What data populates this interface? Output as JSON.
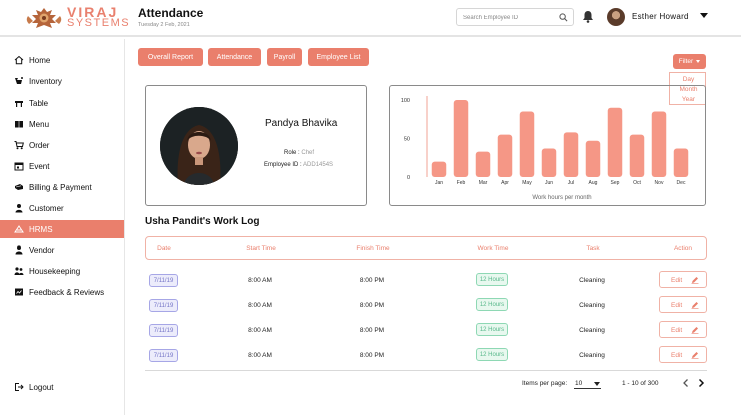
{
  "brand": {
    "line1": "VIRAJ",
    "line2": "SYSTEMS",
    "accent": "#ea7f6c"
  },
  "header": {
    "title": "Attendance",
    "date": "Tuesday 2 Feb, 2021",
    "search_placeholder": "Search Employee ID",
    "user_name": "Esther Howard"
  },
  "sidebar": {
    "items": [
      {
        "label": "Home",
        "icon": "home-icon"
      },
      {
        "label": "Inventory",
        "icon": "inventory-icon"
      },
      {
        "label": "Table",
        "icon": "table-icon"
      },
      {
        "label": "Menu",
        "icon": "menu-book-icon"
      },
      {
        "label": "Order",
        "icon": "cart-icon"
      },
      {
        "label": "Event",
        "icon": "calendar-icon"
      },
      {
        "label": "Billing & Payment",
        "icon": "billing-icon"
      },
      {
        "label": "Customer",
        "icon": "person-icon"
      },
      {
        "label": "HRMS",
        "icon": "hrms-icon"
      },
      {
        "label": "Vendor",
        "icon": "vendor-icon"
      },
      {
        "label": "Housekeeping",
        "icon": "housekeeping-icon"
      },
      {
        "label": "Feedback & Reviews",
        "icon": "feedback-icon"
      }
    ],
    "active": "HRMS",
    "logout": "Logout"
  },
  "tabs": [
    "Overall Report",
    "Attendance",
    "Payroll",
    "Employee List"
  ],
  "filter": {
    "label": "Filter",
    "options": [
      "Day",
      "Month",
      "Year"
    ]
  },
  "profile": {
    "name": "Pandya Bhavika",
    "role_label": "Role :",
    "role": "Chef",
    "id_label": "Employee ID :",
    "id": "ADD1454S"
  },
  "chart_data": {
    "type": "bar",
    "categories": [
      "Jan",
      "Feb",
      "Mar",
      "Apr",
      "May",
      "Jun",
      "Jul",
      "Aug",
      "Sep",
      "Oct",
      "Nov",
      "Dec"
    ],
    "values": [
      20,
      100,
      33,
      55,
      85,
      37,
      58,
      47,
      90,
      55,
      85,
      37
    ],
    "yticks": [
      "100",
      "50",
      "0"
    ],
    "ylim": [
      0,
      100
    ],
    "xlabel": "Work hours per month",
    "bar_color": "#f59786"
  },
  "work_log": {
    "title": "Usha Pandit's Work Log",
    "columns": [
      "Date",
      "Start Time",
      "Finish Time",
      "Work Time",
      "Task",
      "Action"
    ],
    "rows": [
      {
        "date": "7/11/19",
        "start": "8:00 AM",
        "finish": "8:00 PM",
        "work": "12 Hours",
        "task": "Cleaning",
        "action": "Edit"
      },
      {
        "date": "7/11/19",
        "start": "8:00 AM",
        "finish": "8:00 PM",
        "work": "12 Hours",
        "task": "Cleaning",
        "action": "Edit"
      },
      {
        "date": "7/11/19",
        "start": "8:00 AM",
        "finish": "8:00 PM",
        "work": "12 Hours",
        "task": "Cleaning",
        "action": "Edit"
      },
      {
        "date": "7/11/19",
        "start": "8:00 AM",
        "finish": "8:00 PM",
        "work": "12 Hours",
        "task": "Cleaning",
        "action": "Edit"
      }
    ]
  },
  "pagination": {
    "items_per_page_label": "Items per page:",
    "items_per_page": "10",
    "range": "1 - 10 of 300"
  }
}
